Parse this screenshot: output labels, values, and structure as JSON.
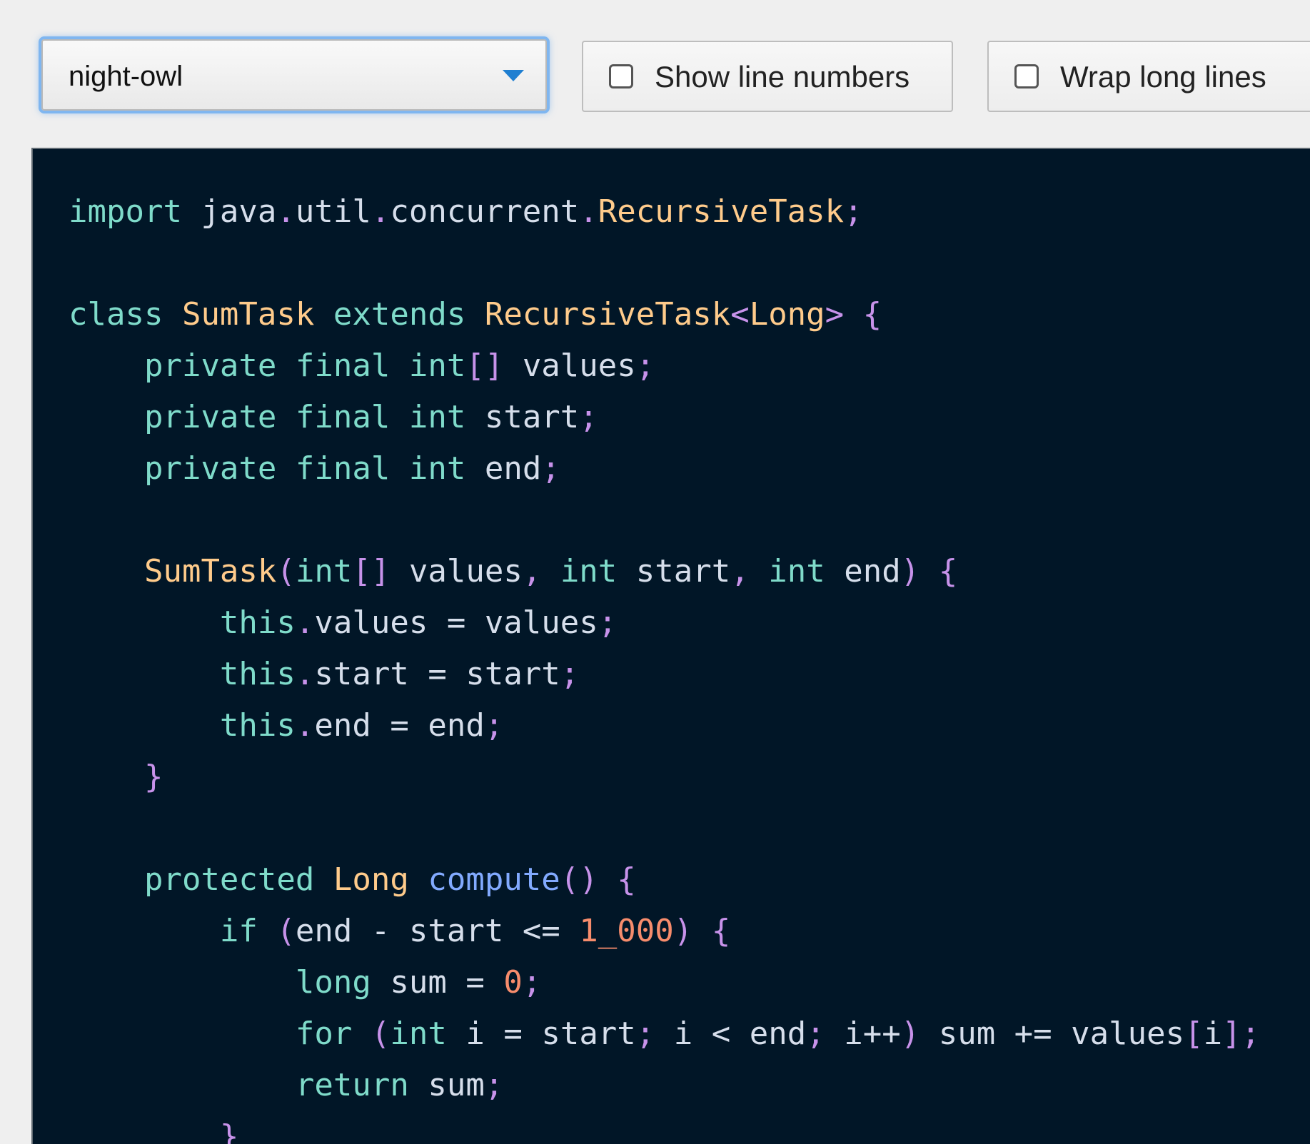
{
  "toolbar": {
    "theme_select": {
      "value": "night-owl"
    },
    "show_line_numbers": {
      "label": "Show line numbers",
      "checked": false
    },
    "wrap_long_lines": {
      "label": "Wrap long lines",
      "checked": false
    }
  },
  "colors": {
    "keyword": "#7fdbca",
    "type": "#ffcb8b",
    "function": "#82aaff",
    "number": "#f78c6c",
    "punctuation": "#c792ea",
    "text": "#d6deeb",
    "background": "#011627"
  },
  "code": {
    "language": "java",
    "lines": [
      [
        [
          "kw",
          "import"
        ],
        [
          "tx",
          " java"
        ],
        [
          "pn",
          "."
        ],
        [
          "tx",
          "util"
        ],
        [
          "pn",
          "."
        ],
        [
          "tx",
          "concurrent"
        ],
        [
          "pn",
          "."
        ],
        [
          "ty",
          "RecursiveTask"
        ],
        [
          "pn",
          ";"
        ]
      ],
      [],
      [
        [
          "kw",
          "class"
        ],
        [
          "tx",
          " "
        ],
        [
          "ty",
          "SumTask"
        ],
        [
          "tx",
          " "
        ],
        [
          "kw",
          "extends"
        ],
        [
          "tx",
          " "
        ],
        [
          "ty",
          "RecursiveTask"
        ],
        [
          "pn",
          "<"
        ],
        [
          "ty",
          "Long"
        ],
        [
          "pn",
          ">"
        ],
        [
          "tx",
          " "
        ],
        [
          "pn",
          "{"
        ]
      ],
      [
        [
          "tx",
          "    "
        ],
        [
          "kw",
          "private"
        ],
        [
          "tx",
          " "
        ],
        [
          "kw",
          "final"
        ],
        [
          "tx",
          " "
        ],
        [
          "kw",
          "int"
        ],
        [
          "pn",
          "[]"
        ],
        [
          "tx",
          " values"
        ],
        [
          "pn",
          ";"
        ]
      ],
      [
        [
          "tx",
          "    "
        ],
        [
          "kw",
          "private"
        ],
        [
          "tx",
          " "
        ],
        [
          "kw",
          "final"
        ],
        [
          "tx",
          " "
        ],
        [
          "kw",
          "int"
        ],
        [
          "tx",
          " start"
        ],
        [
          "pn",
          ";"
        ]
      ],
      [
        [
          "tx",
          "    "
        ],
        [
          "kw",
          "private"
        ],
        [
          "tx",
          " "
        ],
        [
          "kw",
          "final"
        ],
        [
          "tx",
          " "
        ],
        [
          "kw",
          "int"
        ],
        [
          "tx",
          " end"
        ],
        [
          "pn",
          ";"
        ]
      ],
      [],
      [
        [
          "tx",
          "    "
        ],
        [
          "ty",
          "SumTask"
        ],
        [
          "pn",
          "("
        ],
        [
          "kw",
          "int"
        ],
        [
          "pn",
          "[]"
        ],
        [
          "tx",
          " values"
        ],
        [
          "pn",
          ","
        ],
        [
          "tx",
          " "
        ],
        [
          "kw",
          "int"
        ],
        [
          "tx",
          " start"
        ],
        [
          "pn",
          ","
        ],
        [
          "tx",
          " "
        ],
        [
          "kw",
          "int"
        ],
        [
          "tx",
          " end"
        ],
        [
          "pn",
          ")"
        ],
        [
          "tx",
          " "
        ],
        [
          "pn",
          "{"
        ]
      ],
      [
        [
          "tx",
          "        "
        ],
        [
          "kw",
          "this"
        ],
        [
          "pn",
          "."
        ],
        [
          "tx",
          "values "
        ],
        [
          "op",
          "="
        ],
        [
          "tx",
          " values"
        ],
        [
          "pn",
          ";"
        ]
      ],
      [
        [
          "tx",
          "        "
        ],
        [
          "kw",
          "this"
        ],
        [
          "pn",
          "."
        ],
        [
          "tx",
          "start "
        ],
        [
          "op",
          "="
        ],
        [
          "tx",
          " start"
        ],
        [
          "pn",
          ";"
        ]
      ],
      [
        [
          "tx",
          "        "
        ],
        [
          "kw",
          "this"
        ],
        [
          "pn",
          "."
        ],
        [
          "tx",
          "end "
        ],
        [
          "op",
          "="
        ],
        [
          "tx",
          " end"
        ],
        [
          "pn",
          ";"
        ]
      ],
      [
        [
          "tx",
          "    "
        ],
        [
          "pn",
          "}"
        ]
      ],
      [],
      [
        [
          "tx",
          "    "
        ],
        [
          "kw",
          "protected"
        ],
        [
          "tx",
          " "
        ],
        [
          "ty",
          "Long"
        ],
        [
          "tx",
          " "
        ],
        [
          "fn",
          "compute"
        ],
        [
          "pn",
          "()"
        ],
        [
          "tx",
          " "
        ],
        [
          "pn",
          "{"
        ]
      ],
      [
        [
          "tx",
          "        "
        ],
        [
          "kw",
          "if"
        ],
        [
          "tx",
          " "
        ],
        [
          "pn",
          "("
        ],
        [
          "tx",
          "end "
        ],
        [
          "op",
          "-"
        ],
        [
          "tx",
          " start "
        ],
        [
          "op",
          "<="
        ],
        [
          "tx",
          " "
        ],
        [
          "num",
          "1_000"
        ],
        [
          "pn",
          ")"
        ],
        [
          "tx",
          " "
        ],
        [
          "pn",
          "{"
        ]
      ],
      [
        [
          "tx",
          "            "
        ],
        [
          "kw",
          "long"
        ],
        [
          "tx",
          " sum "
        ],
        [
          "op",
          "="
        ],
        [
          "tx",
          " "
        ],
        [
          "num",
          "0"
        ],
        [
          "pn",
          ";"
        ]
      ],
      [
        [
          "tx",
          "            "
        ],
        [
          "kw",
          "for"
        ],
        [
          "tx",
          " "
        ],
        [
          "pn",
          "("
        ],
        [
          "kw",
          "int"
        ],
        [
          "tx",
          " i "
        ],
        [
          "op",
          "="
        ],
        [
          "tx",
          " start"
        ],
        [
          "pn",
          ";"
        ],
        [
          "tx",
          " i "
        ],
        [
          "op",
          "<"
        ],
        [
          "tx",
          " end"
        ],
        [
          "pn",
          ";"
        ],
        [
          "tx",
          " i"
        ],
        [
          "op",
          "++"
        ],
        [
          "pn",
          ")"
        ],
        [
          "tx",
          " sum "
        ],
        [
          "op",
          "+="
        ],
        [
          "tx",
          " values"
        ],
        [
          "pn",
          "["
        ],
        [
          "tx",
          "i"
        ],
        [
          "pn",
          "]"
        ],
        [
          "pn",
          ";"
        ]
      ],
      [
        [
          "tx",
          "            "
        ],
        [
          "kw",
          "return"
        ],
        [
          "tx",
          " sum"
        ],
        [
          "pn",
          ";"
        ]
      ],
      [
        [
          "tx",
          "        "
        ],
        [
          "pn",
          "}"
        ]
      ]
    ]
  }
}
